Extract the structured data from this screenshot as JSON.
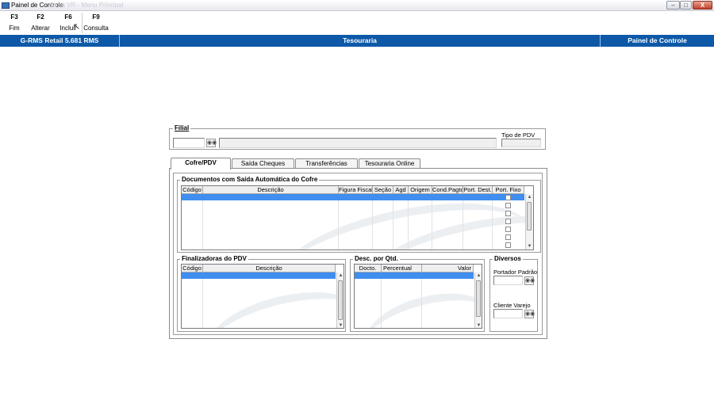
{
  "window": {
    "title": "Painel de Controle",
    "ghost_title": "ga pa VR - Menu Principal",
    "controls": [
      "–",
      "□",
      "X"
    ]
  },
  "toolbar": [
    {
      "key": "F3",
      "label": "Fim"
    },
    {
      "key": "F2",
      "label": "Alterar"
    },
    {
      "key": "F6",
      "label": "Incluir"
    },
    {
      "key": "F9",
      "label": "Consulta"
    }
  ],
  "status_bar": {
    "left": "G-RMS Retail 5.681 RMS",
    "center": "Tesouraria",
    "right": "Painel de Controle"
  },
  "filial": {
    "legend": "Filial",
    "search_icon": "binoculars-icon",
    "tipo_label": "Tipo de PDV"
  },
  "tabs": [
    "Cofre/PDV",
    "Saída Cheques",
    "Transferências",
    "Tesouraria Online"
  ],
  "documentos": {
    "legend": "Documentos com Saída Automática do Cofre",
    "columns": [
      "Código",
      "Descrição",
      "Figura Fiscal",
      "Seção",
      "Agd",
      "Origem",
      "Cond.Pagto",
      "Port. Dest.",
      "Port. Fixo"
    ]
  },
  "finalizadoras": {
    "legend": "Finalizadoras do PDV",
    "columns": [
      "Código",
      "Descrição"
    ]
  },
  "desc_qtd": {
    "legend": "Desc. por Qtd.",
    "columns": [
      "Docto.",
      "Percentual",
      "Valor"
    ]
  },
  "diversos": {
    "legend": "Diversos",
    "portador_label": "Portador Padrão",
    "cliente_label": "Cliente Varejo"
  }
}
